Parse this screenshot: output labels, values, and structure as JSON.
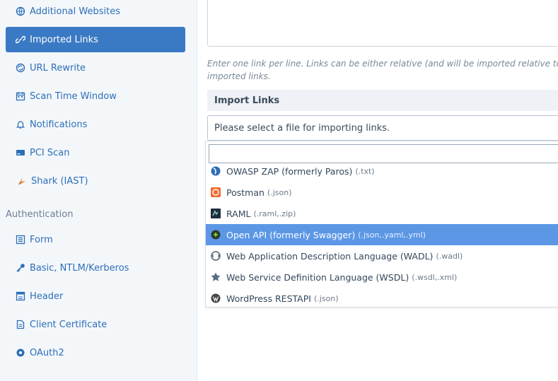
{
  "sidebar": {
    "items": [
      {
        "label": "Additional Websites",
        "icon": "globe-icon"
      },
      {
        "label": "Imported Links",
        "icon": "link-icon",
        "active": true
      },
      {
        "label": "URL Rewrite",
        "icon": "globe-refresh-icon"
      },
      {
        "label": "Scan Time Window",
        "icon": "calendar-icon"
      },
      {
        "label": "Notifications",
        "icon": "bell-icon"
      },
      {
        "label": "PCI Scan",
        "icon": "credit-card-icon"
      },
      {
        "label": "Shark (IAST)",
        "icon": "shark-icon"
      }
    ],
    "auth_heading": "Authentication",
    "auth_items": [
      {
        "label": "Form",
        "icon": "form-icon"
      },
      {
        "label": "Basic, NTLM/Kerberos",
        "icon": "key-icon"
      },
      {
        "label": "Header",
        "icon": "header-icon"
      },
      {
        "label": "Client Certificate",
        "icon": "certificate-icon"
      },
      {
        "label": "OAuth2",
        "icon": "oauth-icon"
      }
    ]
  },
  "main": {
    "help_line1": "Enter one link per line. Links can be either relative (and will be imported relative to the t",
    "help_line2": "imported links.",
    "section_title": "Import Links",
    "select_placeholder": "Please select a file for importing links.",
    "options": [
      {
        "name": "OWASP ZAP (formerly Paros)",
        "ext": "(.txt)",
        "icon": "zap-icon"
      },
      {
        "name": "Postman",
        "ext": "(.json)",
        "icon": "postman-icon"
      },
      {
        "name": "RAML",
        "ext": "(.raml,.zip)",
        "icon": "raml-icon"
      },
      {
        "name": "Open API (formerly Swagger)",
        "ext": "(.json,.yaml,.yml)",
        "icon": "swagger-icon",
        "highlighted": true
      },
      {
        "name": "Web Application Description Language (WADL)",
        "ext": "(.wadl)",
        "icon": "wadl-icon"
      },
      {
        "name": "Web Service Definition Language (WSDL)",
        "ext": "(.wsdl,.xml)",
        "icon": "wsdl-icon"
      },
      {
        "name": "WordPress RESTAPI",
        "ext": "(.json)",
        "icon": "wordpress-icon"
      }
    ]
  },
  "colors": {
    "accent": "#3a79c4",
    "highlight": "#5b97e5",
    "link": "#2c6fb8"
  }
}
